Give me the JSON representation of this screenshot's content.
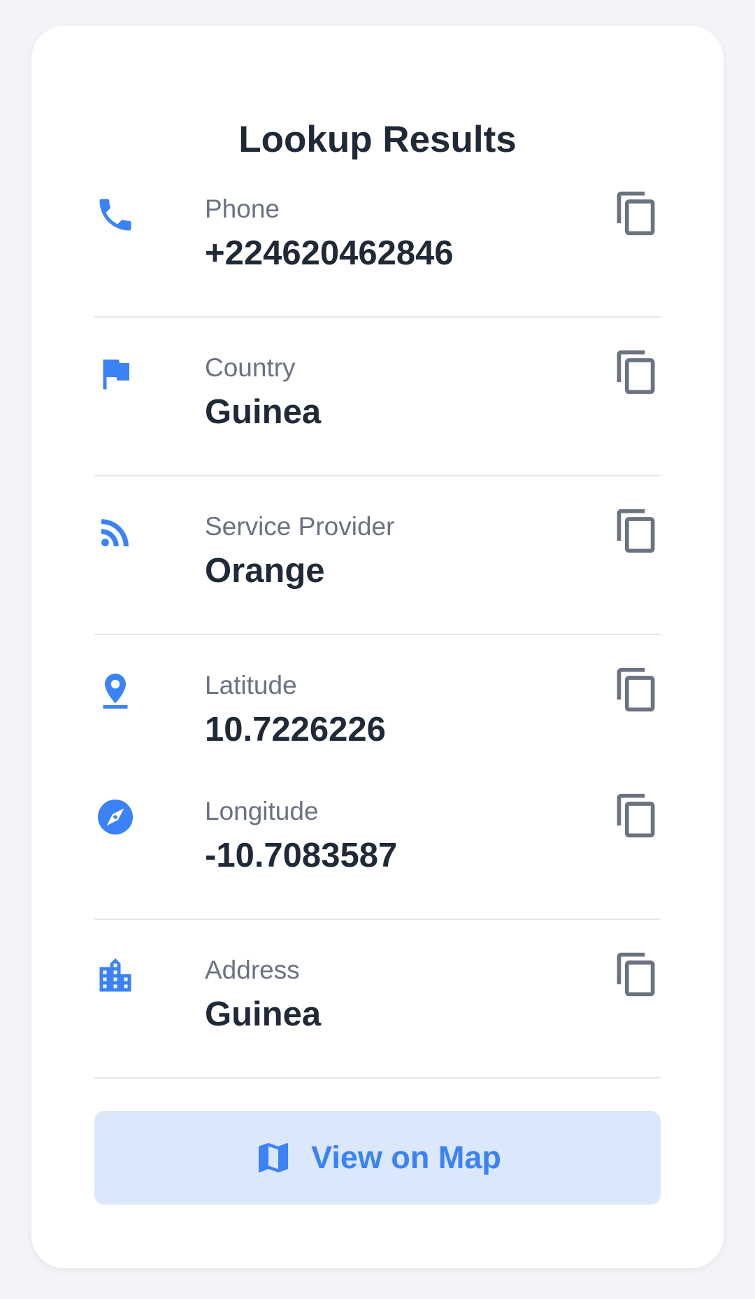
{
  "header": {
    "title": "Lookup Results"
  },
  "colors": {
    "accent": "#3b82f6",
    "label": "#6b7280",
    "value": "#1f2937",
    "copy_icon": "#6b7280",
    "button_bg": "#dbe7fb"
  },
  "fields": [
    {
      "key": "phone",
      "icon": "phone-icon",
      "label": "Phone",
      "value": "+224620462846"
    },
    {
      "key": "country",
      "icon": "flag-icon",
      "label": "Country",
      "value": "Guinea"
    },
    {
      "key": "service_provider",
      "icon": "rss-icon",
      "label": "Service Provider",
      "value": "Orange"
    },
    {
      "key": "latitude",
      "icon": "pin-drop-icon",
      "label": "Latitude",
      "value": "10.7226226"
    },
    {
      "key": "longitude",
      "icon": "compass-icon",
      "label": "Longitude",
      "value": "-10.7083587"
    },
    {
      "key": "address",
      "icon": "city-icon",
      "label": "Address",
      "value": "Guinea"
    }
  ],
  "actions": {
    "copy_icon": "copy-icon",
    "map_icon": "map-icon",
    "view_map_label": "View on Map"
  }
}
